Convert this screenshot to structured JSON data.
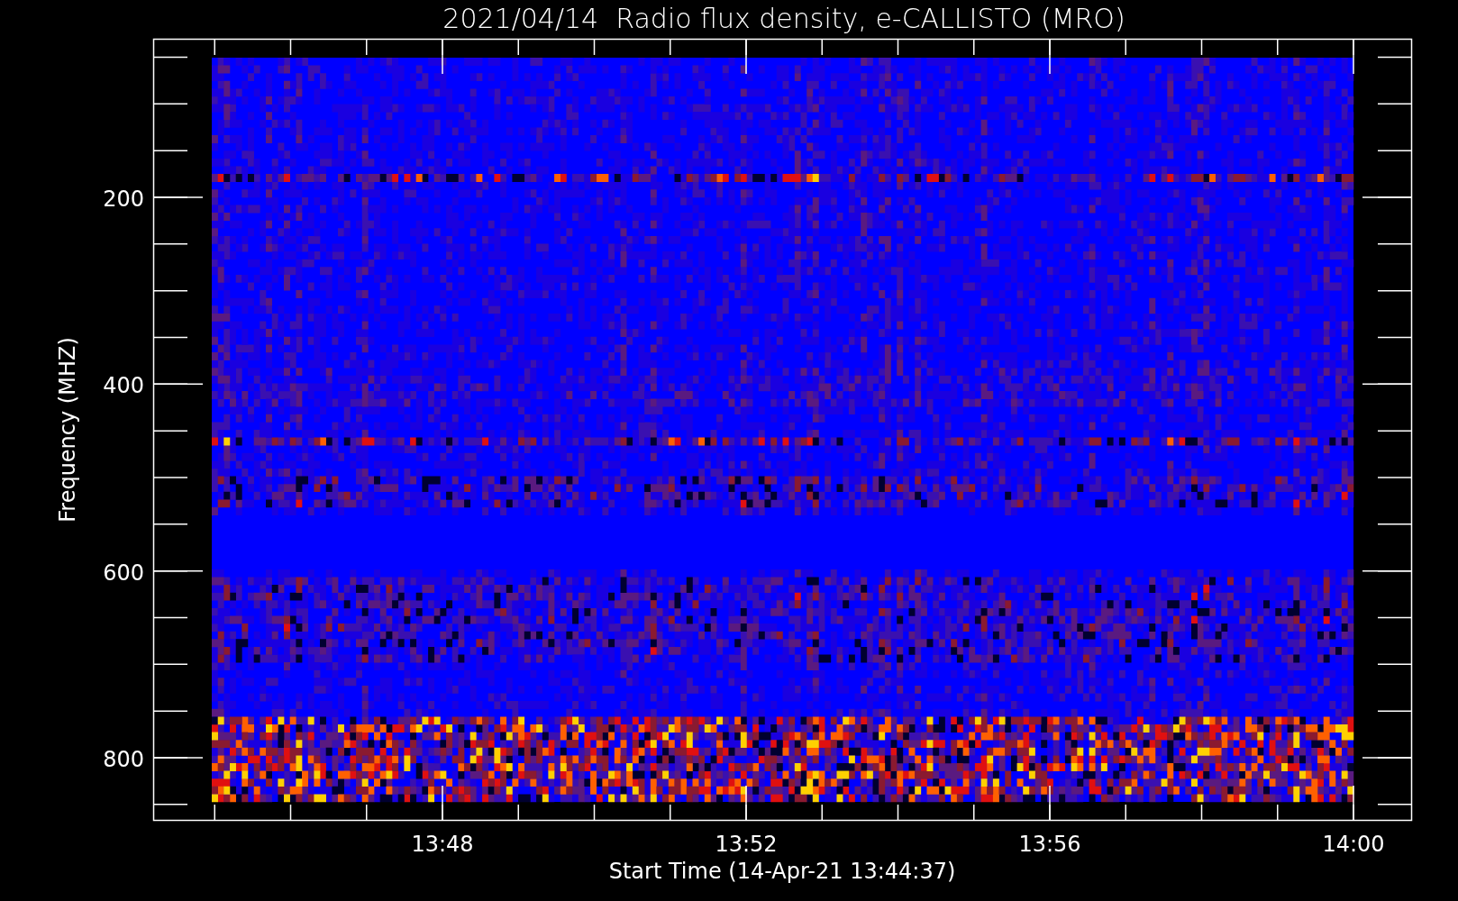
{
  "title": "2021/04/14  Radio flux density, e-CALLISTO (MRO)",
  "y_axis": {
    "label": "Frequency (MHZ)",
    "ticks": [
      "200",
      "400",
      "600",
      "800"
    ]
  },
  "x_axis": {
    "label": "Start Time (14-Apr-21 13:44:37)",
    "ticks": [
      "13:48",
      "13:52",
      "13:56",
      "14:00"
    ]
  }
}
